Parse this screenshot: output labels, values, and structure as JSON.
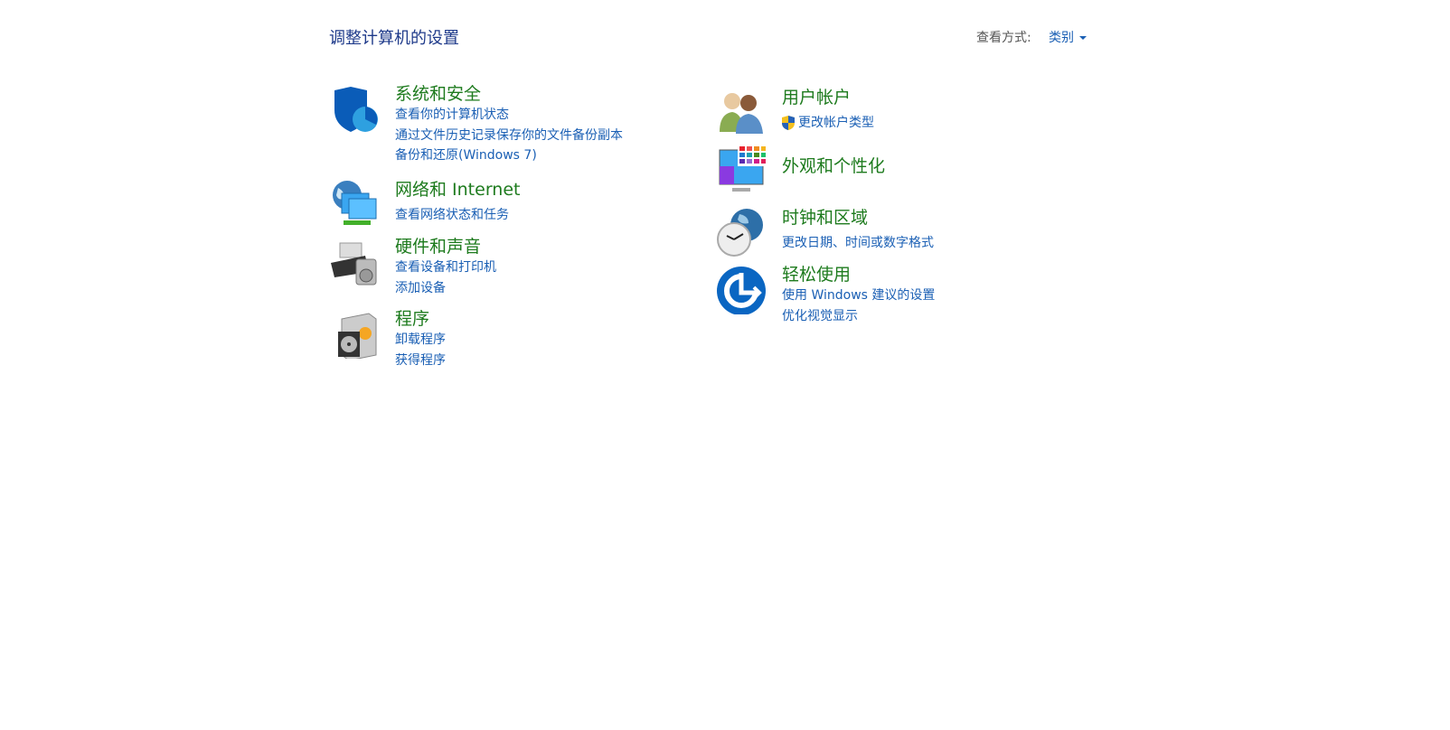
{
  "title": "调整计算机的设置",
  "view_by": {
    "label": "查看方式:",
    "value": "类别"
  },
  "left": [
    {
      "heading": "系统和安全",
      "links": [
        "查看你的计算机状态",
        "通过文件历史记录保存你的文件备份副本",
        "备份和还原(Windows 7)"
      ]
    },
    {
      "heading": "网络和 Internet",
      "links": [
        "查看网络状态和任务"
      ]
    },
    {
      "heading": "硬件和声音",
      "links": [
        "查看设备和打印机",
        "添加设备"
      ]
    },
    {
      "heading": "程序",
      "links": [
        "卸载程序",
        "获得程序"
      ]
    }
  ],
  "right": [
    {
      "heading": "用户帐户",
      "links": [
        "更改帐户类型"
      ]
    },
    {
      "heading": "外观和个性化",
      "links": []
    },
    {
      "heading": "时钟和区域",
      "links": [
        "更改日期、时间或数字格式"
      ]
    },
    {
      "heading": "轻松使用",
      "links": [
        "使用 Windows 建议的设置",
        "优化视觉显示"
      ]
    }
  ]
}
